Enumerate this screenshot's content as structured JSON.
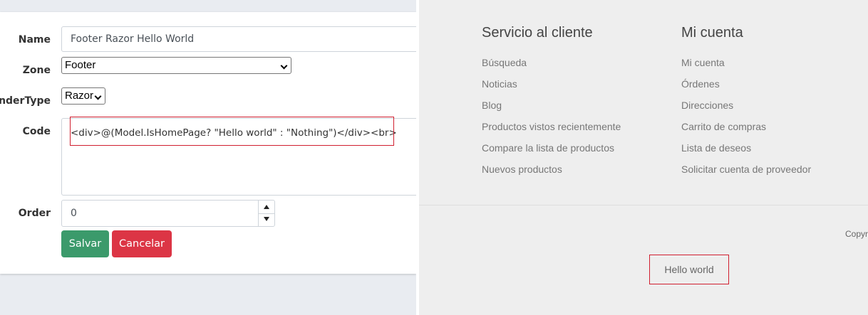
{
  "form": {
    "name_label": "Name",
    "name_value": "Footer Razor Hello World",
    "zone_label": "Zone",
    "zone_value": "Footer",
    "render_type_label": "enderType",
    "render_type_value": "Razor",
    "code_label": "Code",
    "code_value": "<div>@(Model.IsHomePage? \"Hello world\" : \"Nothing\")</div><br>",
    "order_label": "Order",
    "order_value": "0",
    "save_label": "Salvar",
    "cancel_label": "Cancelar"
  },
  "footer": {
    "customer_service": {
      "title": "Servicio al cliente",
      "items": [
        "Búsqueda",
        "Noticias",
        "Blog",
        "Productos vistos recientemente",
        "Compare la lista de productos",
        "Nuevos productos"
      ]
    },
    "my_account": {
      "title": "Mi cuenta",
      "items": [
        "Mi cuenta",
        "Órdenes",
        "Direcciones",
        "Carrito de compras",
        "Lista de deseos",
        "Solicitar cuenta de proveedor"
      ]
    },
    "copyright": "Copyr",
    "hello_text": "Hello world"
  },
  "colors": {
    "save": "#3b9a6b",
    "cancel": "#dc3545",
    "highlight": "#d01f2f"
  }
}
